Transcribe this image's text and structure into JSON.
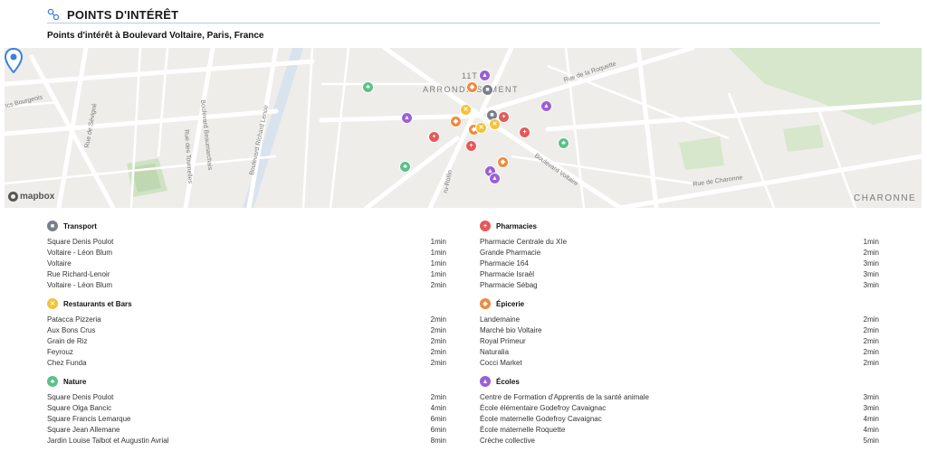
{
  "header": {
    "title": "POINTS D'INTÉRÊT",
    "subtitle": "Points d'intérêt à Boulevard Voltaire, Paris, France"
  },
  "map": {
    "attribution": "mapbox",
    "labels": {
      "arrondissement_num": "11T",
      "arrondissement": "ARRONDISSEMENT",
      "charonne": "CHARONNE",
      "rue_roquette": "Rue de la Roquette",
      "rue_charonne": "Rue de Charonne",
      "bd_voltaire": "Boulevard Voltaire",
      "bd_richard_lenoir": "Boulevard Richard Lenoir",
      "bd_beaumarchais": "Boulevard Beaumarchais",
      "rue_tournelles": "Rue des Tournelles",
      "rue_sevigne": "Rue de Sévigné",
      "bourgeois": "ncs Bourgeois",
      "rollin": "ru-Rollin"
    },
    "colors": {
      "background": "#eeede9",
      "road": "#ffffff",
      "park": "#cfe3c4",
      "canal": "#c9d9ea",
      "pin": "#3d7fe0"
    }
  },
  "categories": {
    "transport": {
      "title": "Transport",
      "icon": "bus-icon",
      "color": "#7a7f8c",
      "items": [
        {
          "name": "Square Denis Poulot",
          "time": "1min"
        },
        {
          "name": "Voltaire - Léon Blum",
          "time": "1min"
        },
        {
          "name": "Voltaire",
          "time": "1min"
        },
        {
          "name": "Rue Richard-Lenoir",
          "time": "1min"
        },
        {
          "name": "Voltaire - Léon Blum",
          "time": "2min"
        }
      ]
    },
    "restaurants": {
      "title": "Restaurants et Bars",
      "icon": "fork-knife-icon",
      "color": "#f2c33b",
      "items": [
        {
          "name": "Patacca Pizzeria",
          "time": "2min"
        },
        {
          "name": "Aux Bons Crus",
          "time": "2min"
        },
        {
          "name": "Grain de Riz",
          "time": "2min"
        },
        {
          "name": "Feyrouz",
          "time": "2min"
        },
        {
          "name": "Chez Funda",
          "time": "2min"
        }
      ]
    },
    "nature": {
      "title": "Nature",
      "icon": "tree-icon",
      "color": "#5cc08a",
      "items": [
        {
          "name": "Square Denis Poulot",
          "time": "2min"
        },
        {
          "name": "Square Olga Bancic",
          "time": "4min"
        },
        {
          "name": "Square Francis Lemarque",
          "time": "6min"
        },
        {
          "name": "Square Jean Allemane",
          "time": "6min"
        },
        {
          "name": "Jardin Louise Talbot et Augustin Avrial",
          "time": "8min"
        }
      ]
    },
    "pharmacies": {
      "title": "Pharmacies",
      "icon": "medical-bag-icon",
      "color": "#e35a5a",
      "items": [
        {
          "name": "Pharmacie Centrale du XIe",
          "time": "1min"
        },
        {
          "name": "Grande Pharmacie",
          "time": "2min"
        },
        {
          "name": "Pharmacie 164",
          "time": "3min"
        },
        {
          "name": "Pharmacie Israël",
          "time": "3min"
        },
        {
          "name": "Pharmacie Sébag",
          "time": "3min"
        }
      ]
    },
    "epicerie": {
      "title": "Épicerie",
      "icon": "shopping-cart-icon",
      "color": "#ee8a3c",
      "items": [
        {
          "name": "Landemaine",
          "time": "2min"
        },
        {
          "name": "Marché bio Voltaire",
          "time": "2min"
        },
        {
          "name": "Royal Primeur",
          "time": "2min"
        },
        {
          "name": "Naturalia",
          "time": "2min"
        },
        {
          "name": "Cocci Market",
          "time": "2min"
        }
      ]
    },
    "ecoles": {
      "title": "Écoles",
      "icon": "graduation-cap-icon",
      "color": "#9b5fd6",
      "items": [
        {
          "name": "Centre de Formation d'Apprentis de la santé animale",
          "time": "3min"
        },
        {
          "name": "École élémentaire Godefroy Cavaignac",
          "time": "3min"
        },
        {
          "name": "École maternelle Godefroy Cavaignac",
          "time": "4min"
        },
        {
          "name": "École maternelle Roquette",
          "time": "4min"
        },
        {
          "name": "Crèche collective",
          "time": "5min"
        }
      ]
    }
  }
}
